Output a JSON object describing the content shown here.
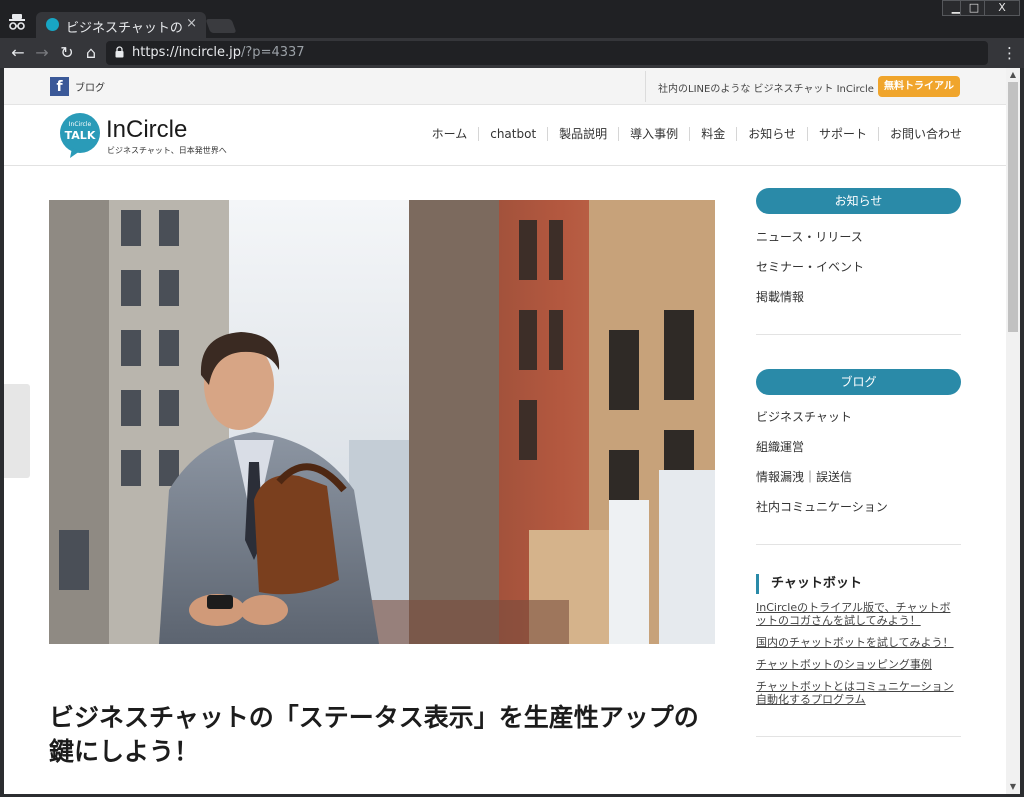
{
  "browser": {
    "tab_title": "ビジネスチャットの「ス",
    "tab_close": "×",
    "url_host": "https://incircle.jp",
    "url_path": "/?p=4337",
    "win_min": "▁",
    "win_max": "□",
    "win_close": "X",
    "back": "←",
    "forward": "→",
    "reload": "↻",
    "home": "⌂",
    "menu": "⋮"
  },
  "util_bar": {
    "facebook_letter": "f",
    "blog_label": "ブログ",
    "tagline": "社内のLINEのような ビジネスチャット InCircle",
    "trial_button": "無料トライアル"
  },
  "header": {
    "logo_bubble_top": "InCircle",
    "logo_bubble_main": "TALK",
    "logo_title": "InCircle",
    "logo_subtitle": "ビジネスチャット、日本発世界へ",
    "nav": [
      "ホーム",
      "chatbot",
      "製品説明",
      "導入事例",
      "料金",
      "お知らせ",
      "サポート",
      "お問い合わせ"
    ]
  },
  "article": {
    "title": "ビジネスチャットの「ステータス表示」を生産性アップの鍵にしよう！"
  },
  "sidebar": {
    "news_heading": "お知らせ",
    "news_links": [
      "ニュース・リリース",
      "セミナー・イベント",
      "掲載情報"
    ],
    "blog_heading": "ブログ",
    "blog_links": [
      "ビジネスチャット",
      "組織運営",
      "情報漏洩｜誤送信",
      "社内コミュニケーション"
    ],
    "chatbot_heading": "チャットボット",
    "chatbot_links": [
      "InCircleのトライアル版で、チャットボットのコガさんを試してみよう！",
      "国内のチャットボットを試してみよう！",
      "チャットボットのショッピング事例",
      "チャットボットとはコミュニケーション自動化するプログラム"
    ]
  },
  "colors": {
    "brand_teal": "#2a8aa8",
    "trial_orange": "#f0a52c",
    "facebook_blue": "#3b5998"
  }
}
